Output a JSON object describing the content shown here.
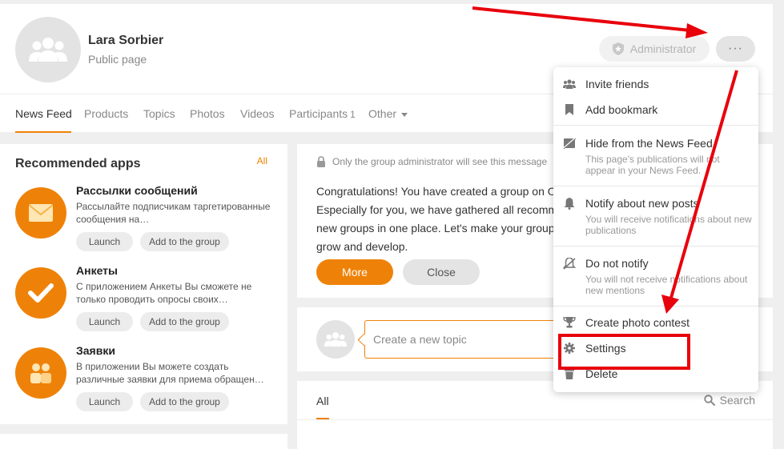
{
  "group": {
    "name": "Lara Sorbier",
    "subtitle": "Public page",
    "admin_label": "Administrator",
    "more_label": "···"
  },
  "tabs": [
    {
      "label": "News Feed"
    },
    {
      "label": "Products"
    },
    {
      "label": "Topics"
    },
    {
      "label": "Photos"
    },
    {
      "label": "Videos"
    },
    {
      "label": "Participants",
      "count": "1"
    },
    {
      "label": "Other"
    }
  ],
  "apps": {
    "title": "Recommended apps",
    "all_label": "All",
    "launch_label": "Launch",
    "add_label": "Add to the group",
    "items": [
      {
        "name": "Рассылки сообщений",
        "desc": "Рассылайте подписчикам таргетированные сообщения на…",
        "icon": "envelope-icon"
      },
      {
        "name": "Анкеты",
        "desc": "С приложением Анкеты Вы сможете не только проводить опросы своих…",
        "icon": "checkmark-icon"
      },
      {
        "name": "Заявки",
        "desc": "В приложении Вы можете создать различные заявки для приема обращен…",
        "icon": "people-icon"
      }
    ]
  },
  "message": {
    "note": "Only the group administrator will see this message",
    "line1": "Congratulations! You have created a group on O",
    "line2": "Especially for you, we have gathered all recomm",
    "line3": "new groups in one place. Let's make your group",
    "line4": "grow and develop.",
    "more_label": "More",
    "close_label": "Close"
  },
  "topic": {
    "placeholder": "Create a new topic"
  },
  "feed": {
    "tab_all": "All",
    "search_label": "Search"
  },
  "dropdown": {
    "items": [
      {
        "label": "Invite friends",
        "icon": "invite-friends-icon"
      },
      {
        "label": "Add bookmark",
        "icon": "bookmark-icon"
      },
      {
        "label": "Hide from the News Feed",
        "desc": "This page's publications will not appear in your News Feed.",
        "icon": "hide-icon"
      },
      {
        "label": "Notify about new posts",
        "desc": "You will receive notifications about new publications",
        "icon": "bell-icon"
      },
      {
        "label": "Do not notify",
        "desc": "You will not receive notifications about new mentions",
        "icon": "bell-off-icon"
      },
      {
        "label": "Create photo contest",
        "icon": "trophy-icon"
      },
      {
        "label": "Settings",
        "icon": "gear-icon"
      },
      {
        "label": "Delete",
        "icon": "trash-icon"
      }
    ]
  },
  "colors": {
    "accent": "#ee8208",
    "annotation_red": "#e8000b"
  }
}
